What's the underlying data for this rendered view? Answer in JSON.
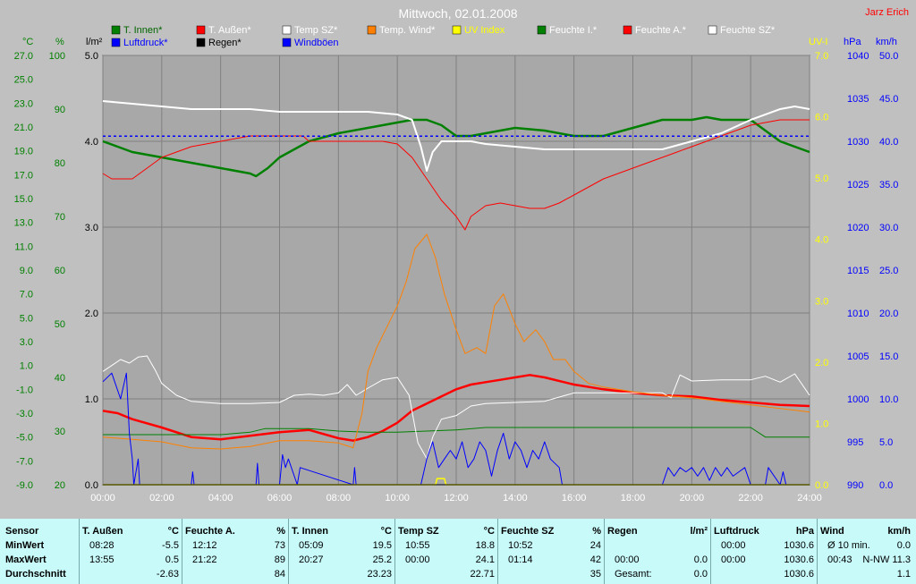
{
  "title": "Mittwoch, 02.01.2008",
  "author": "Jarz Erich",
  "colors": {
    "background": "#a8a8a8",
    "grid": "#808080",
    "t_innen": "#008000",
    "t_aussen": "#ff0000",
    "temp_sz": "#ffffff",
    "temp_wind": "#ff8000",
    "uv": "#ffff00",
    "feuchte_i": "#008000",
    "feuchte_a": "#ff0000",
    "feuchte_sz": "#ffffff",
    "luftdruck": "#0000ff",
    "regen": "#000000",
    "windboeen": "#0000ff"
  },
  "legend": [
    {
      "label": "T. Innen*",
      "color": "#008000",
      "text_color": "#006400"
    },
    {
      "label": "T. Außen*",
      "color": "#ff0000",
      "text_color": "#ffffff"
    },
    {
      "label": "Temp SZ*",
      "color": "#ffffff",
      "text_color": "#ffffff"
    },
    {
      "label": "Temp. Wind*",
      "color": "#ff8000",
      "text_color": "#ffffff"
    },
    {
      "label": "UV Index",
      "color": "#ffff00",
      "text_color": "#ffff00"
    },
    {
      "label": "Feuchte I.*",
      "color": "#008000",
      "text_color": "#ffffff"
    },
    {
      "label": "Feuchte A.*",
      "color": "#ff0000",
      "text_color": "#ffffff"
    },
    {
      "label": "Feuchte SZ*",
      "color": "#ffffff",
      "text_color": "#ffffff"
    },
    {
      "label": "Luftdruck*",
      "color": "#0000ff",
      "text_color": "#0000ff"
    },
    {
      "label": "Regen*",
      "color": "#000000",
      "text_color": "#000000"
    },
    {
      "label": "Windböen",
      "color": "#0000ff",
      "text_color": "#0000ff"
    }
  ],
  "chart_data": {
    "type": "line",
    "title": "Mittwoch, 02.01.2008",
    "x_ticks": [
      "00:00",
      "02:00",
      "04:00",
      "06:00",
      "08:00",
      "10:00",
      "12:00",
      "14:00",
      "16:00",
      "18:00",
      "20:00",
      "22:00",
      "24:00"
    ],
    "xlim": [
      0,
      24
    ],
    "grid": true,
    "axes": {
      "celsius": {
        "unit": "°C",
        "min": -9,
        "max": 27,
        "ticks": [
          "27.0",
          "25.0",
          "23.0",
          "21.0",
          "19.0",
          "17.0",
          "15.0",
          "13.0",
          "11.0",
          "9.0",
          "7.0",
          "5.0",
          "3.0",
          "1.0",
          "-1.0",
          "-3.0",
          "-5.0",
          "-7.0",
          "-9.0"
        ]
      },
      "percent": {
        "unit": "%",
        "min": 20,
        "max": 100,
        "ticks": [
          "100",
          "90",
          "80",
          "70",
          "60",
          "50",
          "40",
          "30",
          "20"
        ]
      },
      "rain": {
        "unit": "l/m²",
        "min": 0,
        "max": 5,
        "ticks": [
          "5.0",
          "4.0",
          "3.0",
          "2.0",
          "1.0",
          "0.0"
        ]
      },
      "uv": {
        "unit": "UV-I",
        "min": 0,
        "max": 7,
        "ticks": [
          "7.0",
          "6.0",
          "5.0",
          "4.0",
          "3.0",
          "2.0",
          "1.0",
          "0.0"
        ]
      },
      "pressure": {
        "unit": "hPa",
        "min": 990,
        "max": 1040,
        "ticks": [
          "1040",
          "1035",
          "1030",
          "1025",
          "1020",
          "1015",
          "1010",
          "1005",
          "1000",
          "995",
          "990"
        ]
      },
      "wind": {
        "unit": "km/h",
        "min": 0,
        "max": 50,
        "ticks": [
          "50.0",
          "45.0",
          "40.0",
          "35.0",
          "30.0",
          "25.0",
          "20.0",
          "15.0",
          "10.0",
          "5.0",
          "0.0"
        ]
      }
    },
    "series": [
      {
        "name": "Feuchte I.*",
        "axis": "percent",
        "color": "#008000",
        "width": 2.5,
        "x": [
          0,
          0.5,
          1,
          2,
          3,
          4,
          5,
          5.2,
          5.6,
          6,
          7,
          8,
          9,
          10,
          10.5,
          11,
          11.5,
          12,
          12.5,
          13,
          14,
          15,
          16,
          17,
          18,
          19,
          20,
          20.5,
          21,
          22,
          22.5,
          23,
          24
        ],
        "y": [
          84,
          83,
          82,
          81,
          80,
          79,
          78,
          77.5,
          79,
          81,
          84,
          85.5,
          86.5,
          87.5,
          88,
          88,
          87,
          85,
          85,
          85.5,
          86.5,
          86,
          85,
          85,
          86.5,
          88,
          88,
          88.5,
          88,
          88,
          86,
          84,
          82
        ]
      },
      {
        "name": "Feuchte A.*",
        "axis": "percent",
        "color": "#ff0000",
        "width": 1,
        "x": [
          0,
          0.3,
          1,
          1.5,
          2,
          2.5,
          3,
          4,
          5,
          6,
          6.8,
          7,
          8,
          9,
          9.5,
          10,
          10.5,
          11,
          11.5,
          12,
          12.3,
          12.5,
          13,
          13.5,
          14,
          14.5,
          15,
          15.5,
          16,
          17,
          18,
          19,
          19.5,
          20,
          21,
          22,
          23,
          24
        ],
        "y": [
          78,
          77,
          77,
          79,
          81,
          82,
          83,
          84,
          85,
          85,
          85,
          84,
          84,
          84,
          84,
          83.5,
          81,
          77,
          73,
          70,
          67.5,
          70,
          72,
          72.5,
          72,
          71.5,
          71.5,
          72.5,
          74,
          77,
          79,
          81,
          82,
          83,
          85,
          87,
          88,
          88
        ]
      },
      {
        "name": "Feuchte SZ*",
        "axis": "percent",
        "color": "#ffffff",
        "width": 2,
        "x": [
          0,
          1,
          2,
          3,
          4,
          5,
          6,
          7,
          8,
          9,
          10,
          10.5,
          10.8,
          11,
          11.2,
          11.5,
          12,
          12.5,
          13,
          14,
          15,
          16,
          17,
          18,
          19,
          20,
          21,
          22,
          23,
          23.5,
          24
        ],
        "y": [
          91.5,
          91,
          90.5,
          90,
          90,
          90,
          89.5,
          89.5,
          89.5,
          89.5,
          89,
          88,
          83,
          78.5,
          82,
          84,
          84,
          84,
          83.5,
          83,
          82.5,
          82.5,
          82.5,
          82.5,
          82.5,
          84,
          85.5,
          88,
          90,
          90.5,
          90
        ]
      },
      {
        "name": "Luftdruck*",
        "axis": "pressure",
        "color": "#0000ff",
        "width": 1.5,
        "dash": "3,3",
        "x": [
          0,
          24
        ],
        "y": [
          1030.6,
          1030.6
        ]
      },
      {
        "name": "T. Außen*",
        "axis": "celsius",
        "color": "#ff0000",
        "width": 2.5,
        "x": [
          0,
          0.5,
          1,
          2,
          3,
          4,
          5,
          6,
          7,
          8,
          8.5,
          9,
          9.5,
          10,
          10.5,
          11,
          11.5,
          12,
          12.5,
          13,
          13.5,
          14,
          14.5,
          15,
          16,
          17,
          18,
          19,
          20,
          21,
          22,
          23,
          24
        ],
        "y": [
          -2.8,
          -3.0,
          -3.5,
          -4.2,
          -5.0,
          -5.2,
          -4.9,
          -4.6,
          -4.4,
          -5.1,
          -5.3,
          -5.0,
          -4.5,
          -3.8,
          -2.8,
          -2.2,
          -1.6,
          -1.0,
          -0.6,
          -0.4,
          -0.2,
          0.0,
          0.2,
          0.0,
          -0.6,
          -1.0,
          -1.3,
          -1.5,
          -1.6,
          -1.9,
          -2.1,
          -2.3,
          -2.4
        ]
      },
      {
        "name": "T. Innen*",
        "axis": "celsius",
        "color": "#008000",
        "width": 1,
        "x": [
          0,
          1,
          2,
          3,
          4,
          5,
          5.5,
          6,
          7,
          8,
          9,
          10,
          11,
          12,
          13,
          14,
          15,
          16,
          17,
          18,
          19,
          20,
          21,
          22,
          22.5,
          23,
          24
        ],
        "y": [
          -4.8,
          -4.8,
          -4.8,
          -4.8,
          -4.8,
          -4.6,
          -4.3,
          -4.3,
          -4.3,
          -4.5,
          -4.6,
          -4.6,
          -4.5,
          -4.4,
          -4.2,
          -4.2,
          -4.2,
          -4.2,
          -4.2,
          -4.2,
          -4.2,
          -4.2,
          -4.2,
          -4.2,
          -5.0,
          -5.0,
          -5.0
        ]
      },
      {
        "name": "Temp SZ*",
        "axis": "celsius",
        "color": "#ffffff",
        "width": 1,
        "x": [
          0,
          0.3,
          0.6,
          0.9,
          1.2,
          1.5,
          1.8,
          2,
          2.5,
          3,
          4,
          5,
          6,
          6.5,
          7,
          7.5,
          8,
          8.3,
          8.6,
          9,
          9.5,
          10,
          10.4,
          10.7,
          11,
          11.2,
          11.5,
          12,
          12.5,
          13,
          14,
          15,
          16,
          17,
          18,
          19,
          19.3,
          19.6,
          20,
          21,
          22,
          22.5,
          23,
          23.5,
          24
        ],
        "y": [
          0.5,
          1.0,
          1.5,
          1.2,
          1.7,
          1.8,
          0.5,
          -0.5,
          -1.5,
          -2.0,
          -2.2,
          -2.2,
          -2.1,
          -1.5,
          -1.4,
          -1.5,
          -1.3,
          -0.6,
          -1.5,
          -0.9,
          -0.2,
          0.0,
          -1.5,
          -5.5,
          -6.8,
          -5.0,
          -3.5,
          -3.2,
          -2.4,
          -2.2,
          -2.1,
          -2.0,
          -1.3,
          -1.3,
          -1.3,
          -1.3,
          -1.7,
          0.2,
          -0.3,
          -0.2,
          -0.2,
          0.1,
          -0.4,
          0.3,
          -1.5
        ]
      },
      {
        "name": "Temp. Wind*",
        "axis": "celsius",
        "color": "#ff8000",
        "width": 1,
        "x": [
          0,
          1,
          2,
          3,
          4,
          5,
          6,
          7,
          8,
          8.5,
          8.8,
          9,
          9.3,
          9.6,
          10,
          10.3,
          10.6,
          11,
          11.3,
          11.6,
          12,
          12.3,
          12.7,
          13,
          13.3,
          13.6,
          14,
          14.3,
          14.7,
          15,
          15.3,
          15.7,
          16,
          16.5,
          17,
          18,
          19,
          20,
          21,
          22,
          23,
          24
        ],
        "y": [
          -5,
          -5.2,
          -5.4,
          -5.9,
          -6.0,
          -5.8,
          -5.3,
          -5.3,
          -5.5,
          -5.9,
          -3,
          0.5,
          2.5,
          4,
          6,
          8,
          10.8,
          12,
          10,
          7,
          4,
          2,
          2.5,
          2,
          6,
          7,
          4.5,
          3,
          4,
          3,
          1.5,
          1.5,
          0.5,
          -0.5,
          -0.8,
          -1.2,
          -1.5,
          -1.7,
          -2.0,
          -2.3,
          -2.6,
          -2.9
        ]
      },
      {
        "name": "Windböen",
        "axis": "wind",
        "color": "#0000ff",
        "width": 1,
        "x": [
          0,
          0.3,
          0.6,
          0.8,
          0.9,
          1,
          1.05,
          1.2,
          1.25,
          3,
          3.05,
          3.1,
          5.2,
          5.25,
          5.3,
          6,
          6.1,
          6.2,
          6.3,
          6.6,
          6.7,
          8.5,
          8.55,
          8.6,
          10.8,
          11,
          11.2,
          11.4,
          11.6,
          11.8,
          12,
          12.2,
          12.4,
          12.6,
          12.8,
          13,
          13.2,
          13.4,
          13.6,
          13.8,
          14,
          14.2,
          14.4,
          14.6,
          14.8,
          15,
          15.2,
          15.5,
          15.6,
          19,
          19.2,
          19.4,
          19.6,
          19.8,
          20,
          20.2,
          20.4,
          20.6,
          20.8,
          21,
          21.2,
          21.4,
          21.6,
          21.8,
          22,
          22.5,
          22.6,
          23,
          23.1,
          23.2
        ],
        "y": [
          12,
          13,
          10,
          13,
          6,
          3,
          0,
          3,
          0,
          0,
          1.5,
          0,
          0,
          2.5,
          0,
          0,
          3.5,
          2,
          3,
          0,
          2,
          0,
          2,
          0,
          0,
          3,
          5,
          2,
          3,
          4,
          3,
          5,
          2,
          3,
          5,
          4,
          1,
          4,
          6,
          3,
          5,
          4,
          2,
          4,
          3,
          5,
          3,
          2,
          0,
          0,
          2,
          1,
          2,
          1.5,
          2,
          1,
          2,
          0.5,
          2,
          1,
          2,
          1,
          1.5,
          2,
          0,
          0,
          2,
          0,
          1.5,
          0
        ]
      },
      {
        "name": "UV Index",
        "axis": "uv",
        "color": "#ffff00",
        "width": 1.5,
        "x": [
          0,
          11.3,
          11.35,
          11.6,
          11.65,
          24
        ],
        "y": [
          0,
          0,
          0.1,
          0.1,
          0,
          0
        ]
      },
      {
        "name": "Regen*",
        "axis": "rain",
        "color": "#000000",
        "width": 1,
        "x": [
          0,
          24
        ],
        "y": [
          0,
          0
        ]
      }
    ]
  },
  "stats": {
    "columns": [
      {
        "header": [
          "Sensor"
        ],
        "rows": [
          [
            "MinWert"
          ],
          [
            "MaxWert"
          ],
          [
            "Durchschnitt"
          ]
        ]
      },
      {
        "header": [
          "T. Außen",
          "°C"
        ],
        "rows": [
          [
            "08:28",
            "-5.5"
          ],
          [
            "13:55",
            "0.5"
          ],
          [
            "",
            "-2.63"
          ]
        ]
      },
      {
        "header": [
          "Feuchte A.",
          "%"
        ],
        "rows": [
          [
            "12:12",
            "73"
          ],
          [
            "21:22",
            "89"
          ],
          [
            "",
            "84"
          ]
        ]
      },
      {
        "header": [
          "T. Innen",
          "°C"
        ],
        "rows": [
          [
            "05:09",
            "19.5"
          ],
          [
            "20:27",
            "25.2"
          ],
          [
            "",
            "23.23"
          ]
        ]
      },
      {
        "header": [
          "Temp SZ",
          "°C"
        ],
        "rows": [
          [
            "10:55",
            "18.8"
          ],
          [
            "00:00",
            "24.1"
          ],
          [
            "",
            "22.71"
          ]
        ]
      },
      {
        "header": [
          "Feuchte SZ",
          "%"
        ],
        "rows": [
          [
            "10:52",
            "24"
          ],
          [
            "01:14",
            "42"
          ],
          [
            "",
            "35"
          ]
        ]
      },
      {
        "header": [
          "Regen",
          "l/m²"
        ],
        "rows": [
          [
            "",
            ""
          ],
          [
            "00:00",
            "0.0"
          ],
          [
            "Gesamt:",
            "0.0"
          ]
        ]
      },
      {
        "header": [
          "Luftdruck",
          "hPa"
        ],
        "rows": [
          [
            "00:00",
            "1030.6"
          ],
          [
            "00:00",
            "1030.6"
          ],
          [
            "",
            "1030.6"
          ]
        ]
      },
      {
        "header": [
          "Wind",
          "km/h"
        ],
        "rows": [
          [
            "Ø 10 min.",
            "0.0"
          ],
          [
            "00:43",
            "N-NW 11.3"
          ],
          [
            "",
            "1.1"
          ]
        ]
      }
    ]
  }
}
